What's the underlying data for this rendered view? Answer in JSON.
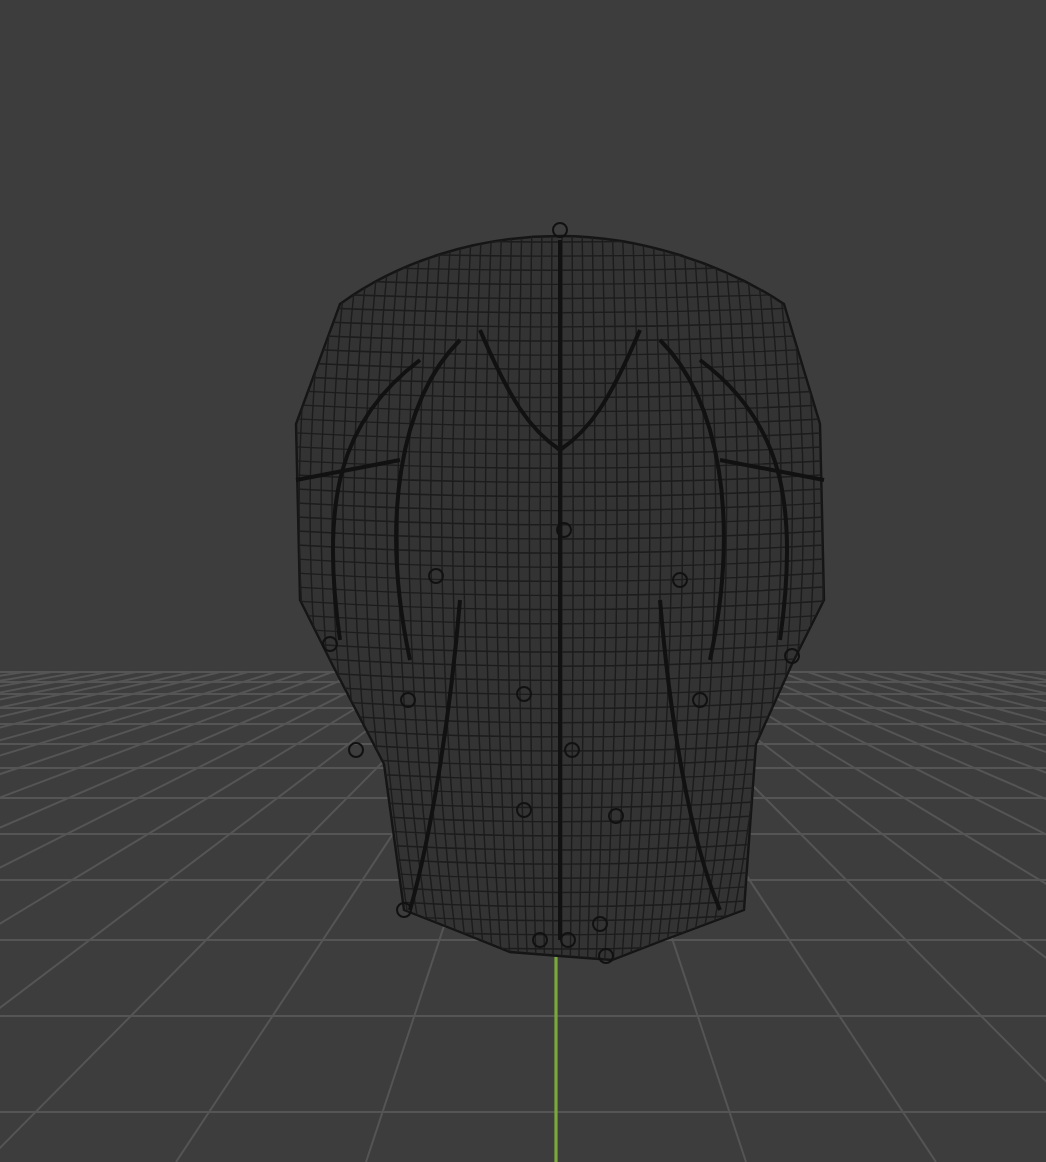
{
  "viewport": {
    "grid_floor": true,
    "y_axis": true
  }
}
